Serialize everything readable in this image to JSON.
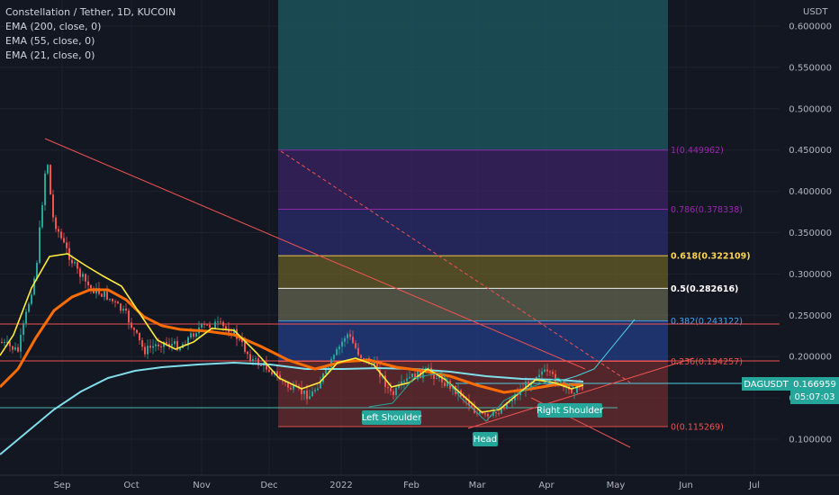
{
  "header": {
    "symbol_title": "Constellation / Tether, 1D, KUCOIN",
    "indicators": [
      "EMA (200, close, 0)",
      "EMA (55, close, 0)",
      "EMA (21, close, 0)"
    ]
  },
  "currency_label": "USDT",
  "price_axis": {
    "ticks": [
      "0.600000",
      "0.550000",
      "0.500000",
      "0.450000",
      "0.400000",
      "0.350000",
      "0.300000",
      "0.250000",
      "0.200000",
      "0.150000",
      "0.100000"
    ],
    "tick_values": [
      0.6,
      0.55,
      0.5,
      0.45,
      0.4,
      0.35,
      0.3,
      0.25,
      0.2,
      0.15,
      0.1
    ]
  },
  "time_axis": {
    "labels": [
      "Sep",
      "Oct",
      "Nov",
      "Dec",
      "2022",
      "Feb",
      "Mar",
      "Apr",
      "May",
      "Jun",
      "Jul"
    ]
  },
  "fib_levels": [
    {
      "label": "1(0.449962)",
      "value": 0.449962,
      "color": "#9c27b0"
    },
    {
      "label": "0.786(0.378338)",
      "value": 0.378338,
      "color": "#9c27b0"
    },
    {
      "label": "0.618(0.322109)",
      "value": 0.322109,
      "color": "#ffd54f"
    },
    {
      "label": "0.5(0.282616)",
      "value": 0.282616,
      "color": "#ffffff"
    },
    {
      "label": "0.382(0.243122)",
      "value": 0.243122,
      "color": "#42a5f5"
    },
    {
      "label": "0.236(0.194257)",
      "value": 0.194257,
      "color": "#ef5350"
    },
    {
      "label": "0(0.115269)",
      "value": 0.115269,
      "color": "#ef5350"
    }
  ],
  "pattern_labels": {
    "left_shoulder": "Left Shoulder",
    "head": "Head",
    "right_shoulder": "Right Shoulder"
  },
  "price_tag": {
    "symbol": "DAGUSDT",
    "price": "0.166959",
    "countdown": "05:07:03"
  },
  "colors": {
    "background": "#131722",
    "ema200": "#80deea",
    "ema55": "#ff6d00",
    "ema21": "#ffeb3b",
    "candle_up": "#26a69a",
    "candle_down": "#ef5350",
    "tag_bg": "#26a69a"
  }
}
